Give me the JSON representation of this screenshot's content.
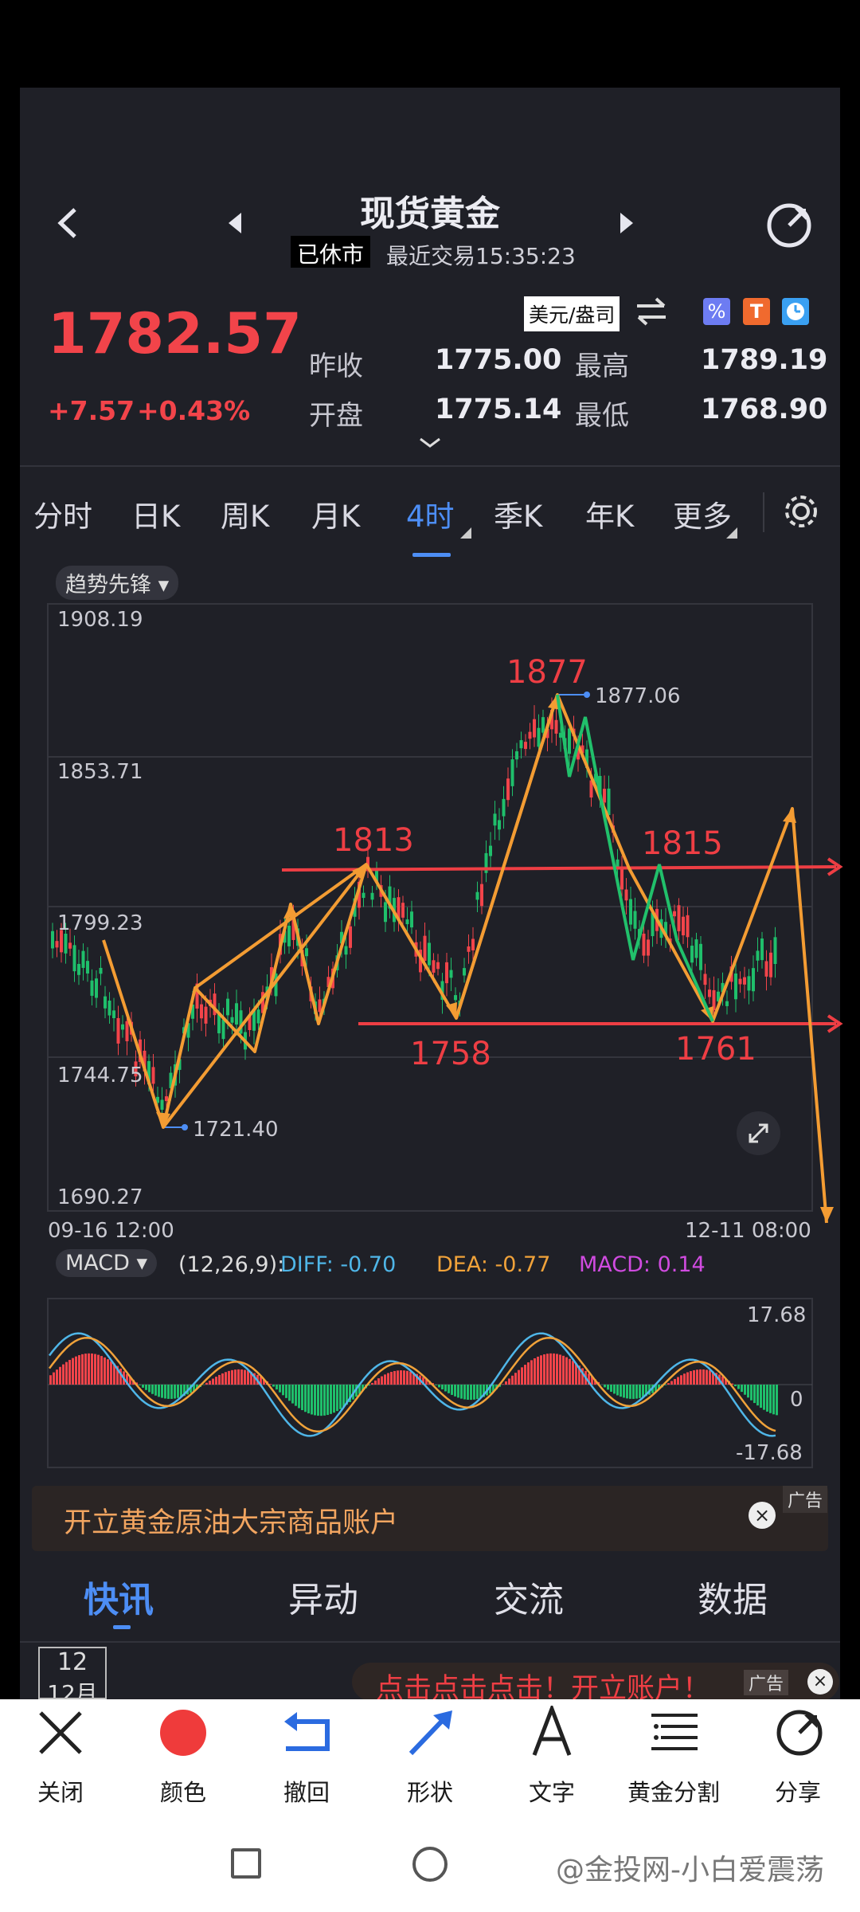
{
  "header": {
    "title": "现货黄金",
    "market_status": "已休市",
    "last_trade": "最近交易15:35:23"
  },
  "quote": {
    "price": "1782.57",
    "change": "+7.57",
    "change_pct": "+0.43%",
    "currency_unit": "美元/盎司",
    "fields": [
      {
        "label": "昨收",
        "value": "1775.00"
      },
      {
        "label": "最高",
        "value": "1789.19"
      },
      {
        "label": "开盘",
        "value": "1775.14"
      },
      {
        "label": "最低",
        "value": "1768.90"
      }
    ]
  },
  "period_tabs": [
    "分时",
    "日K",
    "周K",
    "月K",
    "4时",
    "季K",
    "年K",
    "更多"
  ],
  "active_tab": "4时",
  "main_chart": {
    "indicator_button": "趋势先锋",
    "y_ticks": [
      "1908.19",
      "1853.71",
      "1799.23",
      "1744.75",
      "1690.27"
    ],
    "x_start": "09-16 12:00",
    "x_end": "12-11 08:00",
    "high_marker": "1877.06",
    "low_marker": "1721.40",
    "annotations": [
      "1877",
      "1813",
      "1815",
      "1758",
      "1761"
    ]
  },
  "macd": {
    "button": "MACD",
    "params": "(12,26,9):",
    "diff": "DIFF: -0.70",
    "dea": "DEA: -0.77",
    "macd": "MACD: 0.14",
    "y_top": "17.68",
    "y_mid": "0",
    "y_bottom": "-17.68"
  },
  "ad_banner": {
    "text": "开立黄金原油大宗商品账户",
    "tag": "广告"
  },
  "feed_tabs": [
    "快讯",
    "异动",
    "交流",
    "数据"
  ],
  "active_feed_tab": "快讯",
  "date_box": {
    "day": "12",
    "month": "12月"
  },
  "float_ad": {
    "text": "点击点击点击！开立账户！",
    "tag": "广告"
  },
  "tools": [
    {
      "label": "关闭",
      "icon": "close-icon"
    },
    {
      "label": "颜色",
      "icon": "color-dot-icon"
    },
    {
      "label": "撤回",
      "icon": "undo-icon"
    },
    {
      "label": "形状",
      "icon": "arrow-shape-icon"
    },
    {
      "label": "文字",
      "icon": "text-a-icon"
    },
    {
      "label": "黄金分割",
      "icon": "golden-ratio-icon"
    },
    {
      "label": "分享",
      "icon": "share-icon"
    }
  ],
  "watermark": "@金投网-小白爱震荡",
  "colors": {
    "up": "#f2444a",
    "down": "#1fbf6b",
    "accent": "#4d8ef5",
    "draw": "#f39c33"
  }
}
